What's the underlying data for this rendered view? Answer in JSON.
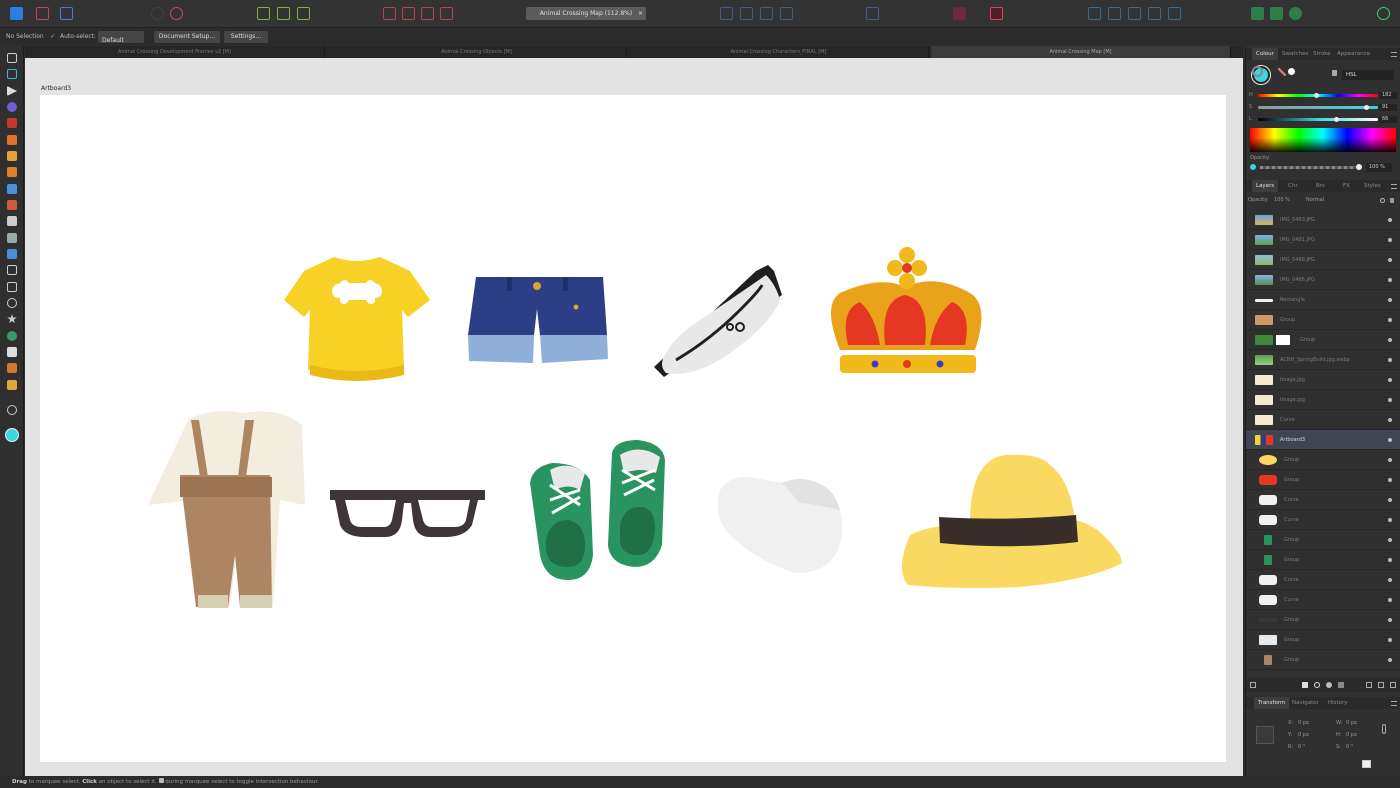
{
  "toolbar": {
    "document_select": "Animal Crossing Map (112.8%)"
  },
  "context_bar": {
    "selection": "No Selection",
    "auto_select_label": "Auto-select:",
    "auto_select_value": "Default",
    "document_setup": "Document Setup...",
    "settings": "Settings..."
  },
  "tabs": [
    {
      "label": "Animal Crossing Development Frames v2 [M]"
    },
    {
      "label": "Animal Crossing Objects [M]"
    },
    {
      "label": "Animal Crossing Characters_FINAL [M]"
    },
    {
      "label": "Animal Crossing Map [M]",
      "active": true
    }
  ],
  "canvas": {
    "artboard_label": "Artboard3"
  },
  "status": {
    "drag": "Drag",
    "drag_text": " to marquee select. ",
    "click": "Click",
    "click_text": " an object to select it. ",
    "alt_text": " during marquee select to toggle intersection behaviour."
  },
  "colour_panel": {
    "tabs": [
      "Colour",
      "Swatches",
      "Stroke",
      "Appearance"
    ],
    "model": "HSL",
    "h_label": "H",
    "h_value": "182",
    "s_label": "S",
    "s_value": "91",
    "l_label": "L",
    "l_value": "66",
    "opacity_label": "Opacity",
    "opacity_value": "100 %",
    "accent_color": "#3ad5e0"
  },
  "layers_panel": {
    "tabs": [
      "Layers",
      "Chr",
      "Brs",
      "FX",
      "Styles"
    ],
    "opacity_label": "Opacity:",
    "opacity_value": "100 %",
    "blend": "Normal",
    "layers": [
      {
        "name": "IMG_0483.JPG"
      },
      {
        "name": "IMG_0481.JPG"
      },
      {
        "name": "IMG_0488.JPG"
      },
      {
        "name": "IMG_0486.JPG"
      },
      {
        "name": "Rectangle"
      },
      {
        "name": "Group"
      },
      {
        "name": "Group"
      },
      {
        "name": "ACNH_SpringBuild.jpg.webp"
      },
      {
        "name": "Image.jpg"
      },
      {
        "name": "Image.jpg"
      },
      {
        "name": "Curve"
      },
      {
        "name": "Artboard3"
      },
      {
        "name": "Group"
      },
      {
        "name": "Group"
      },
      {
        "name": "Curve"
      },
      {
        "name": "Curve"
      },
      {
        "name": "Group"
      },
      {
        "name": "Group"
      },
      {
        "name": "Curve"
      },
      {
        "name": "Curve"
      },
      {
        "name": "Group"
      },
      {
        "name": "Group"
      },
      {
        "name": "Group"
      }
    ]
  },
  "transform_panel": {
    "tabs": [
      "Transform",
      "Navigator",
      "History"
    ],
    "x_label": "X:",
    "x_value": "0 px",
    "y_label": "Y:",
    "y_value": "0 px",
    "w_label": "W:",
    "w_value": "0 px",
    "h_label": "H:",
    "h_value": "0 px",
    "r_label": "R:",
    "r_value": "0 °",
    "s_label": "S:",
    "s_value": "0 °"
  }
}
